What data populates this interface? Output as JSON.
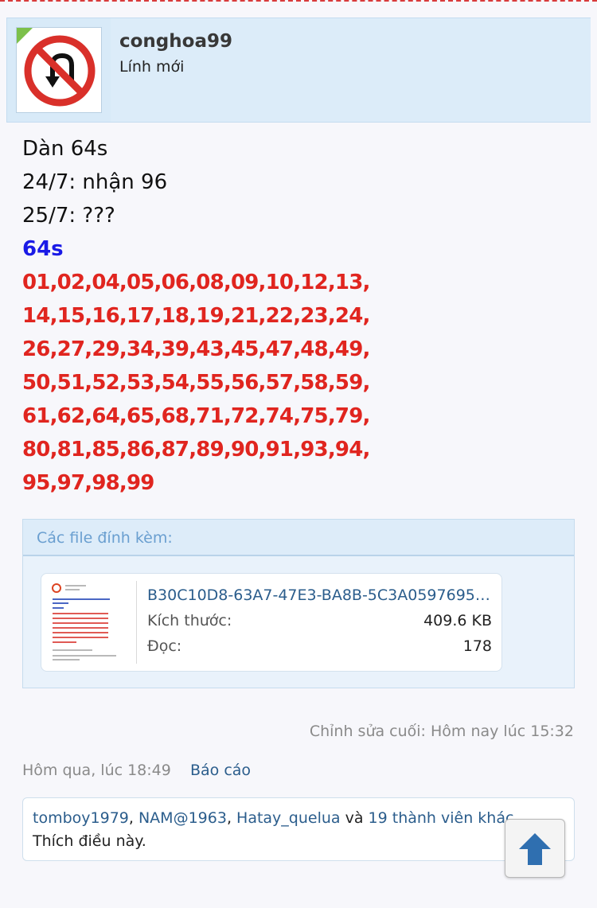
{
  "user": {
    "username": "conghoa99",
    "title": "Lính mới"
  },
  "post": {
    "lines": [
      "Dàn 64s",
      "24/7: nhận 96",
      "25/7: ???"
    ],
    "highlight": "64s",
    "number_rows": [
      "01,02,04,05,06,08,09,10,12,13,",
      "14,15,16,17,18,19,21,22,23,24,",
      "26,27,29,34,39,43,45,47,48,49,",
      "50,51,52,53,54,55,56,57,58,59,",
      "61,62,64,65,68,71,72,74,75,79,",
      "80,81,85,86,87,89,90,91,93,94,",
      "95,97,98,99"
    ]
  },
  "attachments": {
    "title": "Các file đính kèm:",
    "file": {
      "name": "B30C10D8-63A7-47E3-BA8B-5C3A05976952...",
      "size_label": "Kích thước:",
      "size_value": "409.6 KB",
      "reads_label": "Đọc:",
      "reads_value": "178"
    }
  },
  "meta": {
    "edited": "Chỉnh sửa cuối: Hôm nay lúc 15:32",
    "date": "Hôm qua, lúc 18:49",
    "report": "Báo cáo"
  },
  "likes": {
    "user1": "tomboy1979",
    "sep1": ", ",
    "user2": "NAM@1963",
    "sep2": ", ",
    "user3": "Hatay_quelua",
    "conj": " và ",
    "others": "19 thành viên khác",
    "text": "Thích điều này."
  },
  "icons": {
    "avatar": "no-u-turn-sign-icon",
    "scroll": "arrow-up-icon"
  },
  "colors": {
    "numbers_red": "#e0251f",
    "highlight_blue": "#1a1ae6",
    "link_blue": "#2b5d8c",
    "header_bg": "#d8eaf8"
  }
}
